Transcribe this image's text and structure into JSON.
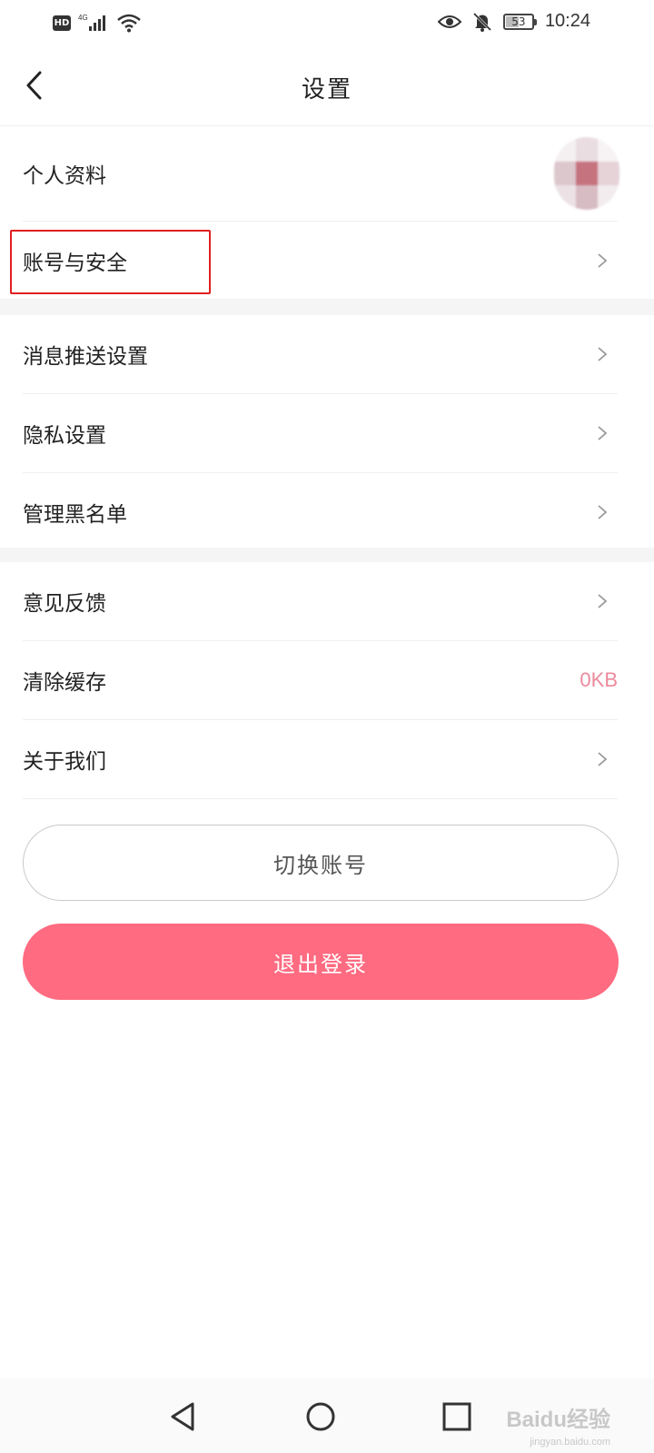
{
  "status_bar": {
    "hd_label": "HD",
    "network_label": "4G",
    "battery_level": "53",
    "battery_fraction": 0.53,
    "time": "10:24",
    "icons": [
      "hd-icon",
      "signal-icon",
      "wifi-icon",
      "eye-icon",
      "bell-muted-icon",
      "battery-icon"
    ]
  },
  "header": {
    "title": "设置",
    "back_icon": "chevron-left-icon"
  },
  "groups": [
    {
      "items": [
        {
          "label": "个人资料",
          "trailing": "avatar"
        },
        {
          "label": "账号与安全",
          "trailing": "chevron",
          "highlighted": true
        }
      ]
    },
    {
      "items": [
        {
          "label": "消息推送设置",
          "trailing": "chevron"
        },
        {
          "label": "隐私设置",
          "trailing": "chevron"
        },
        {
          "label": "管理黑名单",
          "trailing": "chevron"
        }
      ]
    },
    {
      "items": [
        {
          "label": "意见反馈",
          "trailing": "chevron"
        },
        {
          "label": "清除缓存",
          "trailing": "value",
          "value": "0KB"
        },
        {
          "label": "关于我们",
          "trailing": "chevron"
        }
      ]
    }
  ],
  "buttons": {
    "switch_account": "切换账号",
    "logout": "退出登录"
  },
  "nav_bar": {
    "icons": [
      "back-triangle-icon",
      "home-circle-icon",
      "recents-square-icon"
    ]
  },
  "watermark": {
    "text": "Baidu经验",
    "subtext": "jingyan.baidu.com"
  },
  "colors": {
    "accent": "#ff6b81",
    "value_text": "#ec8a9c",
    "highlight_border": "#e02020",
    "divider": "#f5f5f5"
  }
}
